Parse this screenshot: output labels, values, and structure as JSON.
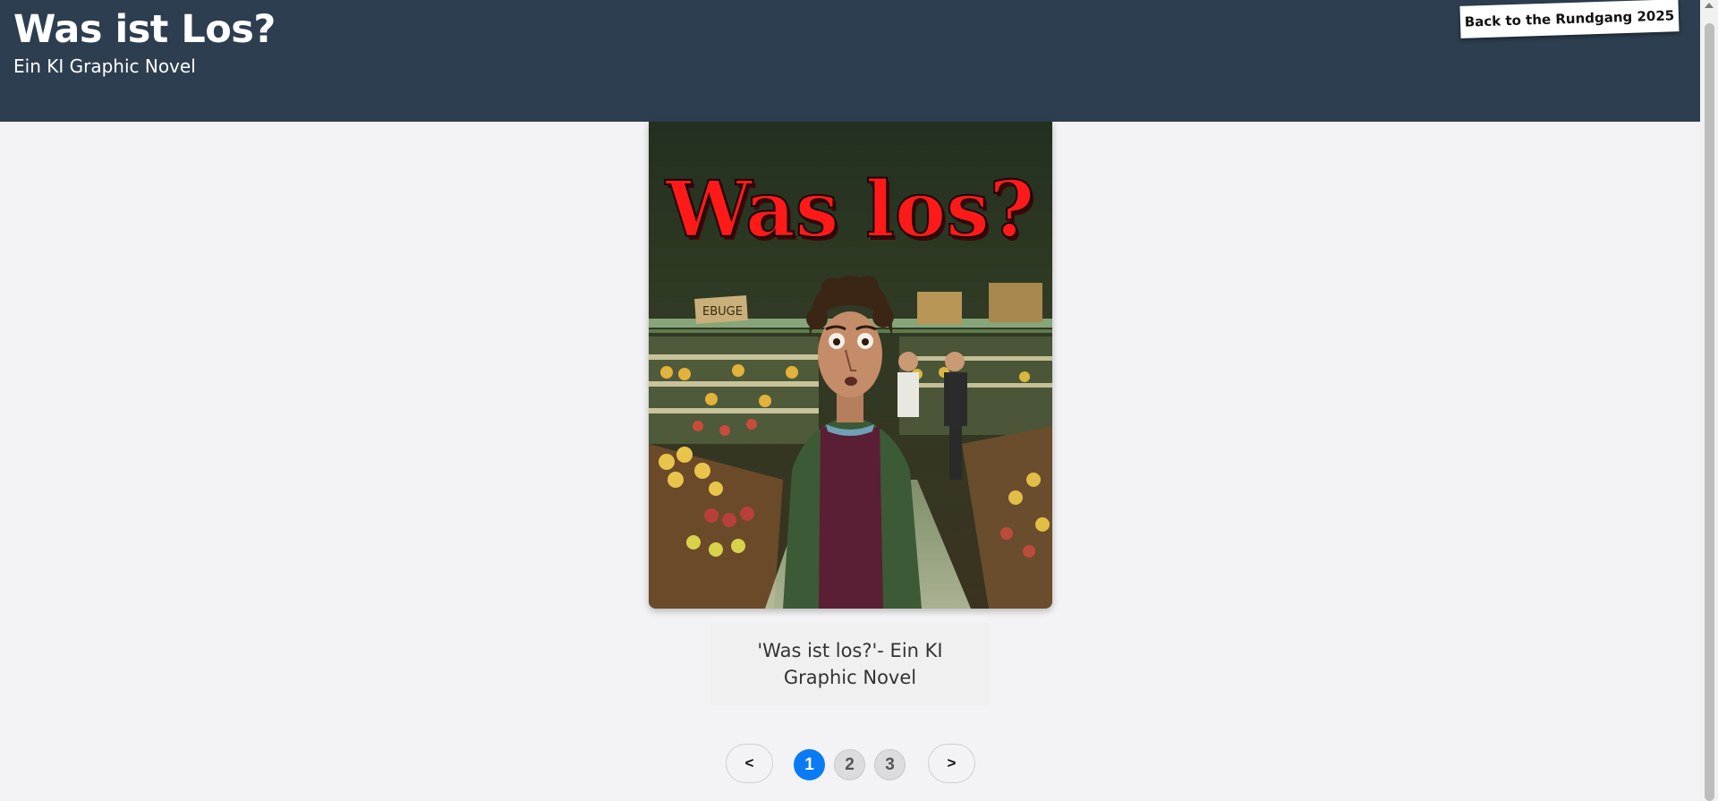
{
  "header": {
    "title": "Was ist Los?",
    "subtitle": "Ein KI Graphic Novel",
    "back_button_label": "Back to the Rundgang 2025",
    "background": "#2d3e50"
  },
  "cover": {
    "title_art_text": "Was los?",
    "sign_text": "EBUGE",
    "title_color": "#ff1a1a"
  },
  "caption": "'Was ist los?'- Ein KI Graphic Novel",
  "pagination": {
    "prev_label": "<",
    "next_label": ">",
    "pages": [
      "1",
      "2",
      "3"
    ],
    "current_page": "1",
    "active_color": "#0a7bf3"
  }
}
